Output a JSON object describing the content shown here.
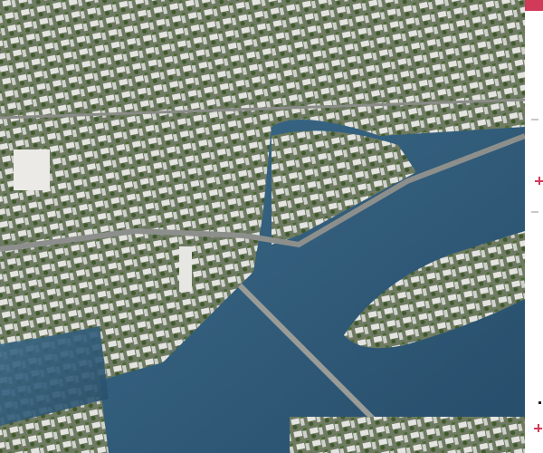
{
  "scene": {
    "subject": "aerial-3d-city-render",
    "water_color": "#2f5a78",
    "accent_color": "#d23a5a"
  },
  "side_strip": {
    "controls": [
      "dash",
      "plus",
      "dash",
      "dot",
      "plus"
    ]
  }
}
